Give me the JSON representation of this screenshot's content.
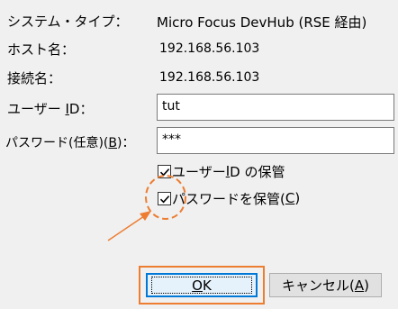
{
  "dialog": {
    "system_type_label": "システム・タイプ：",
    "system_type_value": "Micro Focus DevHub (RSE 経由)",
    "host_label": "ホスト名：",
    "host_value": "192.168.56.103",
    "connection_label": "接続名：",
    "connection_value": "192.168.56.103",
    "user_id_label_prefix": "ユーザー ",
    "user_id_label_mnemonic": "I",
    "user_id_label_suffix": "D：",
    "user_id_value": "tut",
    "password_label_prefix": "パスワード(任意)(",
    "password_label_mnemonic": "B",
    "password_label_suffix": ")：",
    "password_value": "***",
    "save_user_id_prefix": "ユーザー ",
    "save_user_id_mnemonic": "I",
    "save_user_id_suffix": "D の保管",
    "save_user_id_checked": true,
    "save_password_prefix": "パスワードを保管(",
    "save_password_mnemonic": "C",
    "save_password_suffix": ")",
    "save_password_checked": true,
    "ok_mnemonic": "O",
    "ok_suffix": "K",
    "cancel_prefix": "キャンセル(",
    "cancel_mnemonic": "A",
    "cancel_suffix": ")"
  },
  "colors": {
    "annotation": "#ed7d31",
    "focus_border": "#0078d7"
  }
}
